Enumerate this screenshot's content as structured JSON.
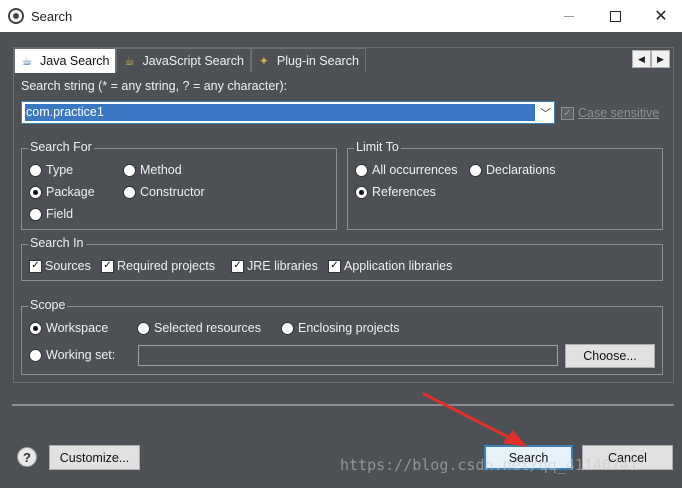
{
  "window": {
    "title": "Search"
  },
  "tabs": [
    {
      "label": "Java Search",
      "active": true,
      "icon": "java-search-icon"
    },
    {
      "label": "JavaScript Search",
      "active": false,
      "icon": "javascript-search-icon"
    },
    {
      "label": "Plug-in Search",
      "active": false,
      "icon": "plugin-search-icon"
    }
  ],
  "search_string": {
    "label": "Search string (* = any string, ? = any character):",
    "value": "com.practice1"
  },
  "case_sensitive": {
    "label": "Case sensitive",
    "checked": true,
    "enabled": false
  },
  "search_for": {
    "title": "Search For",
    "options": [
      "Type",
      "Method",
      "Package",
      "Constructor",
      "Field"
    ],
    "selected": "Package"
  },
  "limit_to": {
    "title": "Limit To",
    "options": [
      "All occurrences",
      "Declarations",
      "References"
    ],
    "selected": "References"
  },
  "search_in": {
    "title": "Search In",
    "options": [
      "Sources",
      "Required projects",
      "JRE libraries",
      "Application libraries"
    ]
  },
  "scope": {
    "title": "Scope",
    "workspace": "Workspace",
    "selected_resources": "Selected resources",
    "enclosing_projects": "Enclosing projects",
    "working_set": "Working set:",
    "working_set_value": "",
    "choose_label": "Choose...",
    "selected": "Workspace"
  },
  "footer": {
    "help": "?",
    "customize_label": "Customize...",
    "search_label": "Search",
    "cancel_label": "Cancel"
  },
  "watermark": "https://blog.csdn.net/qq_41140741",
  "colors": {
    "background": "#4d5155",
    "accent": "#3c7fb1",
    "arrow": "#e0302a"
  }
}
